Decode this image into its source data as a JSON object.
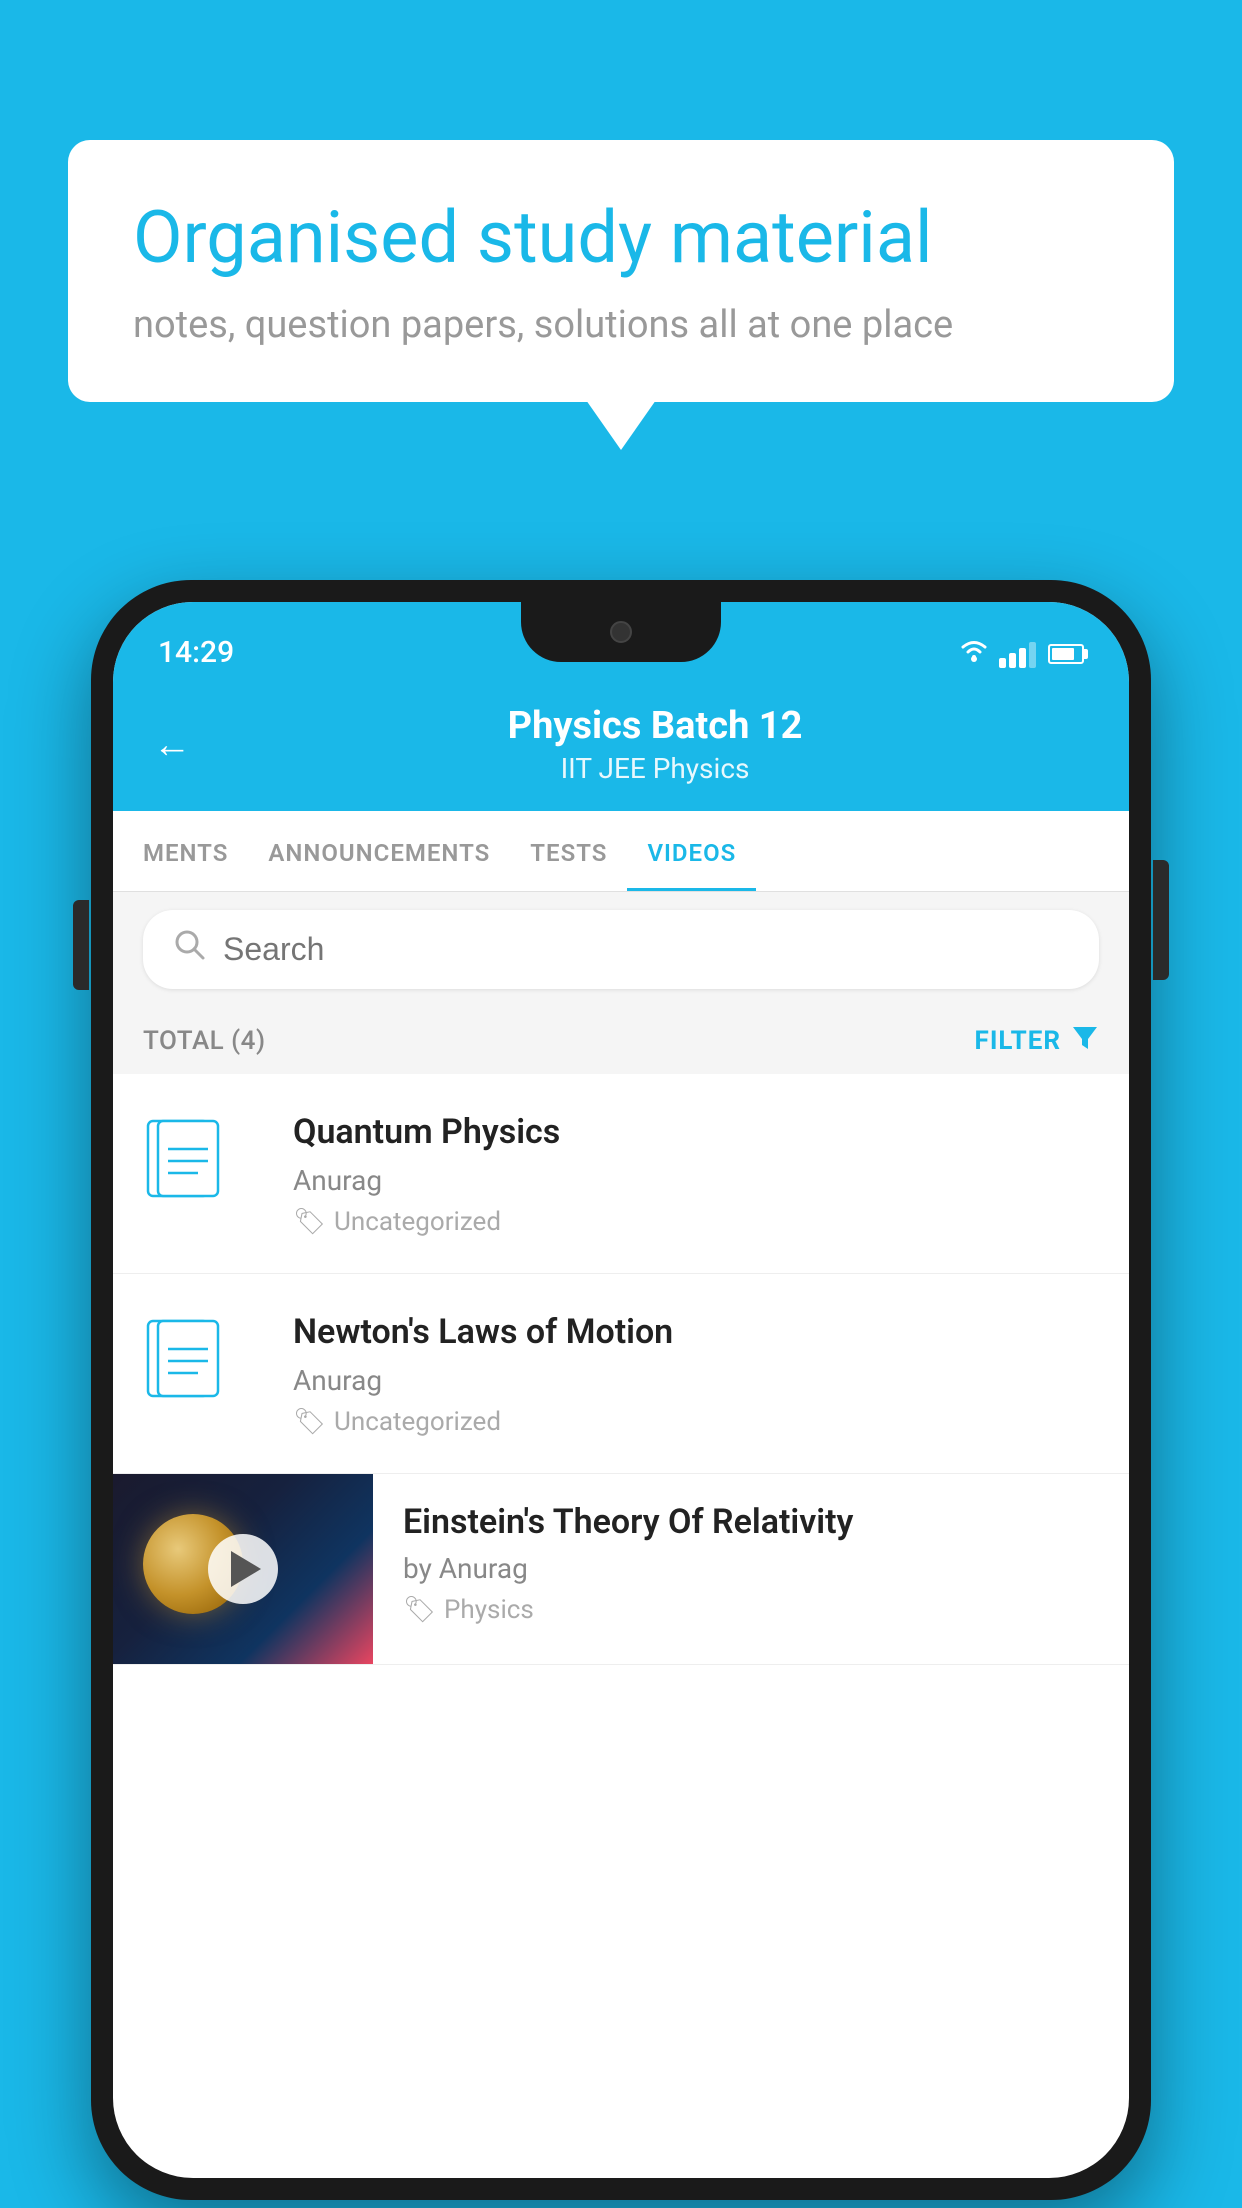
{
  "background": {
    "color": "#1ab8e8"
  },
  "speech_bubble": {
    "title": "Organised study material",
    "subtitle": "notes, question papers, solutions all at one place"
  },
  "status_bar": {
    "time": "14:29"
  },
  "app_header": {
    "title": "Physics Batch 12",
    "subtitle": "IIT JEE   Physics",
    "back_label": "←"
  },
  "tabs": [
    {
      "label": "MENTS",
      "active": false
    },
    {
      "label": "ANNOUNCEMENTS",
      "active": false
    },
    {
      "label": "TESTS",
      "active": false
    },
    {
      "label": "VIDEOS",
      "active": true
    }
  ],
  "search": {
    "placeholder": "Search"
  },
  "filter_bar": {
    "total_label": "TOTAL (4)",
    "filter_label": "FILTER"
  },
  "videos": [
    {
      "title": "Quantum Physics",
      "author": "Anurag",
      "tag": "Uncategorized",
      "has_thumb": false
    },
    {
      "title": "Newton's Laws of Motion",
      "author": "Anurag",
      "tag": "Uncategorized",
      "has_thumb": false
    },
    {
      "title": "Einstein's Theory Of Relativity",
      "author": "by Anurag",
      "tag": "Physics",
      "has_thumb": true
    }
  ]
}
